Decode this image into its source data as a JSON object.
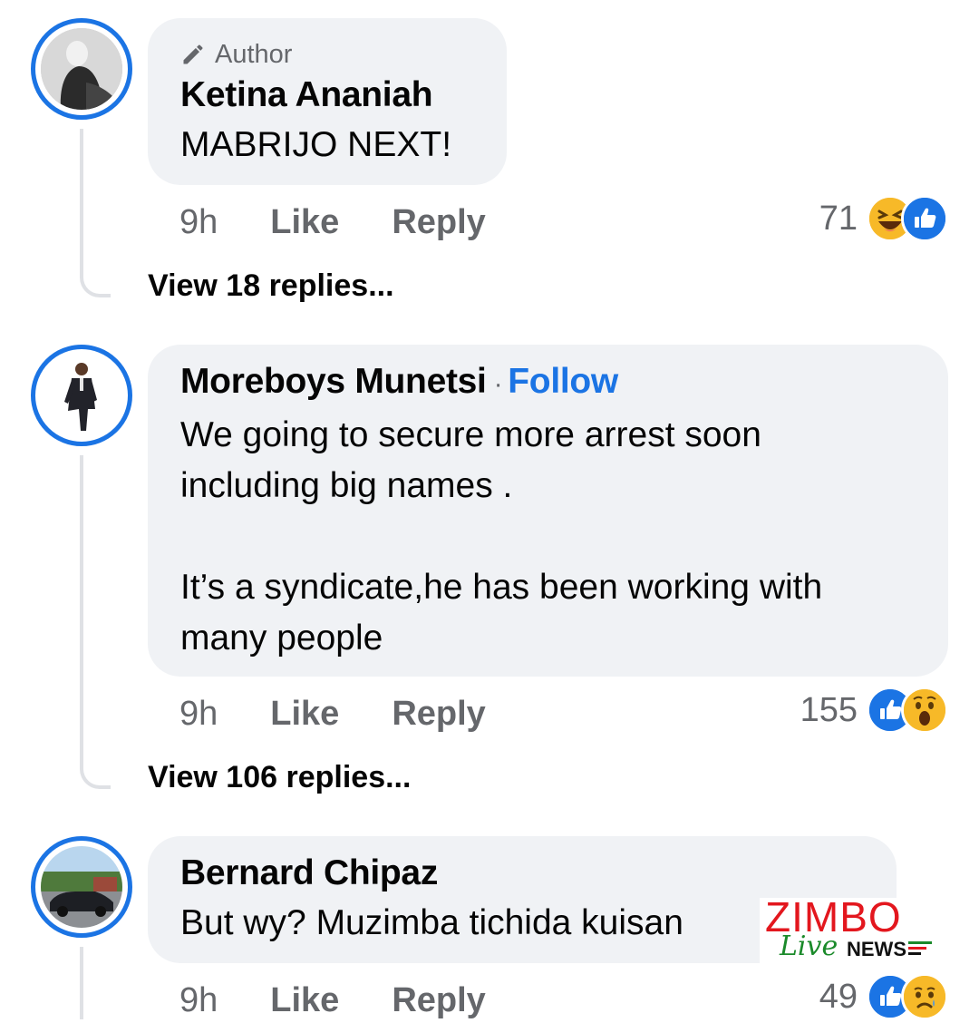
{
  "comments": [
    {
      "author_tag": "Author",
      "name": "Ketina Ananiah",
      "text": "MABRIJO NEXT!",
      "time": "9h",
      "like_label": "Like",
      "reply_label": "Reply",
      "reaction_count": "71",
      "reactions": [
        "haha-icon",
        "like-icon"
      ],
      "view_replies": "View 18 replies..."
    },
    {
      "name": "Moreboys Munetsi",
      "separator": "·",
      "follow_label": "Follow",
      "text": "We going to secure more arrest soon\nincluding big names .\n\nIt’s a syndicate,he has been working with\nmany people",
      "time": "9h",
      "like_label": "Like",
      "reply_label": "Reply",
      "reaction_count": "155",
      "reactions": [
        "like-icon",
        "wow-icon"
      ],
      "view_replies": "View 106 replies..."
    },
    {
      "name": "Bernard Chipaz",
      "text": "But wy? Muzimba tichida kuisan",
      "time": "9h",
      "like_label": "Like",
      "reply_label": "Reply",
      "reaction_count": "49",
      "reactions": [
        "like-icon",
        "sad-icon"
      ]
    }
  ],
  "watermark": {
    "line1": "ZIMBO",
    "live": "Live",
    "news": "NEWS"
  },
  "colors": {
    "accent": "#1b74e4",
    "bubble": "#f0f2f5",
    "muted": "#65676b",
    "watermark_red": "#e3171e",
    "watermark_green": "#1a8a2a"
  }
}
